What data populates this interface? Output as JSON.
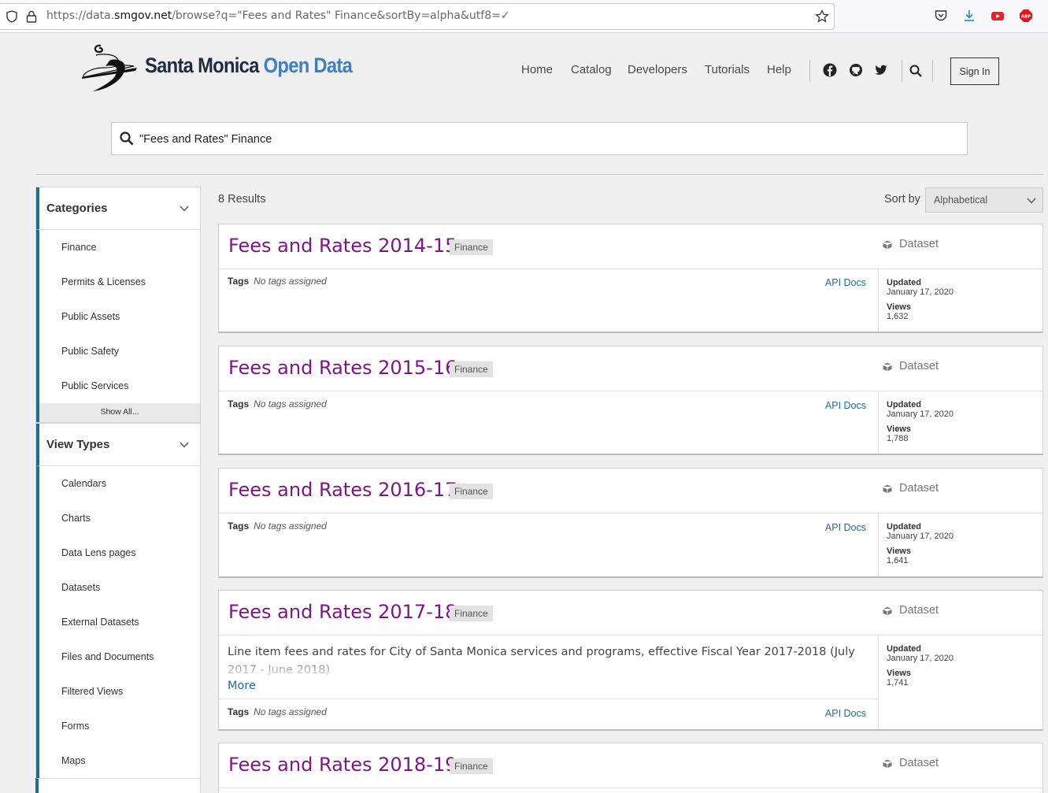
{
  "browser": {
    "url_prefix": "https://data.",
    "url_host": "smgov.net",
    "url_rest": "/browse?q=\"Fees and Rates\" Finance&sortBy=alpha&utf8=✓"
  },
  "header": {
    "logo_part1": "Santa Monica",
    "logo_part2": "Open Data",
    "nav": [
      "Home",
      "Catalog",
      "Developers",
      "Tutorials",
      "Help"
    ],
    "sign_in": "Sign In"
  },
  "search": {
    "value": "\"Fees and Rates\" Finance"
  },
  "sidebar": {
    "categories_title": "Categories",
    "categories": [
      "Finance",
      "Permits & Licenses",
      "Public Assets",
      "Public Safety",
      "Public Services"
    ],
    "show_all": "Show All...",
    "view_types_title": "View Types",
    "view_types": [
      "Calendars",
      "Charts",
      "Data Lens pages",
      "Datasets",
      "External Datasets",
      "Files and Documents",
      "Filtered Views",
      "Forms",
      "Maps"
    ]
  },
  "results": {
    "count": "8 Results",
    "sort_label": "Sort by",
    "sort_value": "Alphabetical",
    "items": [
      {
        "title": "Fees and Rates 2014-15",
        "category": "Finance",
        "type": "Dataset",
        "tags_label": "Tags",
        "tags": "No tags assigned",
        "api": "API Docs",
        "updated_label": "Updated",
        "updated": "January 17, 2020",
        "views_label": "Views",
        "views": "1,632"
      },
      {
        "title": "Fees and Rates 2015-16",
        "category": "Finance",
        "type": "Dataset",
        "tags_label": "Tags",
        "tags": "No tags assigned",
        "api": "API Docs",
        "updated_label": "Updated",
        "updated": "January 17, 2020",
        "views_label": "Views",
        "views": "1,788"
      },
      {
        "title": "Fees and Rates 2016-17",
        "category": "Finance",
        "type": "Dataset",
        "tags_label": "Tags",
        "tags": "No tags assigned",
        "api": "API Docs",
        "updated_label": "Updated",
        "updated": "January 17, 2020",
        "views_label": "Views",
        "views": "1,641"
      },
      {
        "title": "Fees and Rates 2017-18",
        "category": "Finance",
        "type": "Dataset",
        "description": "Line item fees and rates for City of Santa Monica services and programs, effective Fiscal Year 2017-2018 (July 2017 - June 2018)",
        "more": "More",
        "tags_label": "Tags",
        "tags": "No tags assigned",
        "api": "API Docs",
        "updated_label": "Updated",
        "updated": "January 17, 2020",
        "views_label": "Views",
        "views": "1,741"
      },
      {
        "title": "Fees and Rates 2018-19",
        "category": "Finance",
        "type": "Dataset"
      }
    ]
  }
}
